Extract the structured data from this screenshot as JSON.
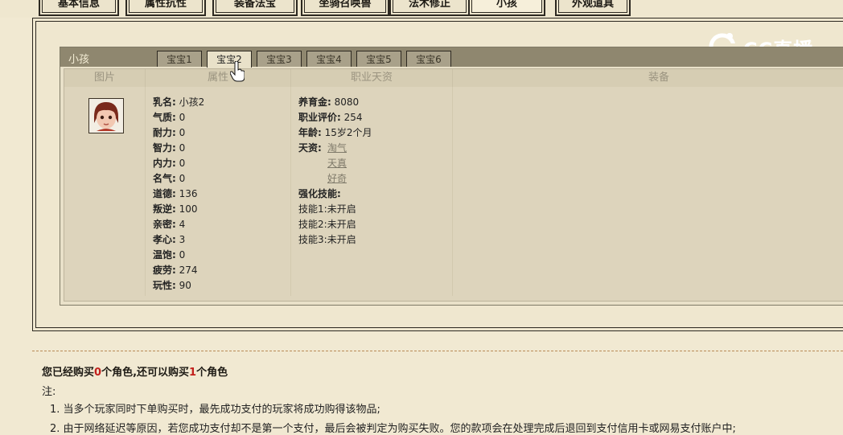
{
  "top_tabs": [
    {
      "label": "基本信息",
      "active": false
    },
    {
      "label": "属性抗性",
      "active": false
    },
    {
      "label": "装备法宝",
      "active": false
    },
    {
      "label": "坐骑召唤兽",
      "active": false
    },
    {
      "label": "法术修正",
      "active": false
    },
    {
      "label": "小孩",
      "active": true
    },
    {
      "label": "外观道具",
      "active": false
    }
  ],
  "panel": {
    "title": "小孩",
    "subtabs": [
      "宝宝1",
      "宝宝2",
      "宝宝3",
      "宝宝4",
      "宝宝5",
      "宝宝6"
    ],
    "active_subtab": "宝宝2",
    "columns": [
      "图片",
      "属性",
      "职业天资",
      "装备"
    ]
  },
  "attributes": [
    {
      "label": "乳名:",
      "value": "小孩2"
    },
    {
      "label": "气质:",
      "value": "0"
    },
    {
      "label": "耐力:",
      "value": "0"
    },
    {
      "label": "智力:",
      "value": "0"
    },
    {
      "label": "内力:",
      "value": "0"
    },
    {
      "label": "名气:",
      "value": "0"
    },
    {
      "label": "道德:",
      "value": "136"
    },
    {
      "label": "叛逆:",
      "value": "100"
    },
    {
      "label": "亲密:",
      "value": "4"
    },
    {
      "label": "孝心:",
      "value": "3"
    },
    {
      "label": "温饱:",
      "value": "0"
    },
    {
      "label": "疲劳:",
      "value": "274"
    },
    {
      "label": "玩性:",
      "value": "90"
    }
  ],
  "career": {
    "rows": [
      {
        "label": "养育金:",
        "value": "8080"
      },
      {
        "label": "职业评价:",
        "value": "254"
      },
      {
        "label": "年龄:",
        "value": "15岁2个月"
      }
    ],
    "talent_label": "天资:",
    "talents": [
      "淘气",
      "天真",
      "好奇"
    ],
    "skill_header": "强化技能:",
    "skills": [
      {
        "label": "技能1:",
        "value": "未开启"
      },
      {
        "label": "技能2:",
        "value": "未开启"
      },
      {
        "label": "技能3:",
        "value": "未开启"
      }
    ]
  },
  "purchase": {
    "prefix": "您已经购买",
    "bought": "0",
    "middle": "个角色,还可以购买",
    "remaining": "1",
    "suffix": "个角色"
  },
  "notes": {
    "label": "注:",
    "items": [
      "1. 当多个玩家同时下单购买时，最先成功支付的玩家将成功购得该物品;",
      "2. 由于网络延迟等原因，若您成功支付却不是第一个支付，最后会被判定为购买失败。您的款项会在处理完成后退回到支付信用卡或网易支付账户中;"
    ]
  },
  "watermark": "CC直播",
  "colors": {
    "accent_red": "#c2201c",
    "panel_header": "#8f876f"
  },
  "icons": {
    "avatar": "child-avatar",
    "cursor": "hand-cursor-icon",
    "logo": "cc-live-logo"
  }
}
